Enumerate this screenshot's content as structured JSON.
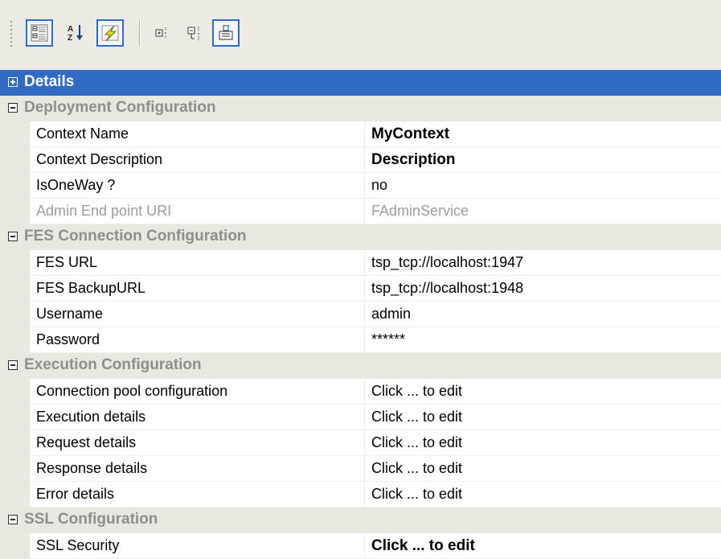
{
  "toolbar": {
    "buttons": [
      {
        "icon": "categorized-icon",
        "pressed": true
      },
      {
        "icon": "alphabetical-sort-icon",
        "pressed": false
      },
      {
        "icon": "properties-lightning-icon",
        "pressed": true
      },
      {
        "icon": "collapse-all-icon",
        "pressed": false
      },
      {
        "icon": "expand-all-icon",
        "pressed": false
      },
      {
        "icon": "property-pages-icon",
        "pressed": true
      }
    ]
  },
  "grid": {
    "details": {
      "label": "Details"
    },
    "deployment": {
      "label": "Deployment Configuration",
      "context_name": {
        "name": "Context Name",
        "value": "MyContext"
      },
      "context_description": {
        "name": "Context Description",
        "value": "Description"
      },
      "is_one_way": {
        "name": "IsOneWay ?",
        "value": "no"
      },
      "admin_uri": {
        "name": "Admin End point URI",
        "value": "FAdminService"
      }
    },
    "fes": {
      "label": "FES Connection Configuration",
      "url": {
        "name": "FES URL",
        "value": "tsp_tcp://localhost:1947"
      },
      "backup_url": {
        "name": "FES BackupURL",
        "value": "tsp_tcp://localhost:1948"
      },
      "username": {
        "name": "Username",
        "value": "admin"
      },
      "password": {
        "name": "Password",
        "value": "******"
      }
    },
    "execution": {
      "label": "Execution Configuration",
      "pool": {
        "name": "Connection pool configuration",
        "value": "Click ... to edit"
      },
      "exec_details": {
        "name": "Execution details",
        "value": "Click ... to edit"
      },
      "request": {
        "name": "Request details",
        "value": "Click ... to edit"
      },
      "response": {
        "name": "Response details",
        "value": "Click ... to edit"
      },
      "error": {
        "name": "Error details",
        "value": "Click ... to edit"
      }
    },
    "ssl": {
      "label": "SSL Configuration",
      "security": {
        "name": "SSL Security",
        "value": "Click ... to edit"
      }
    }
  },
  "colors": {
    "selection": "#316ac5",
    "category_bg": "#e9e8e0",
    "toolbar_bg": "#ebebe3",
    "pressed_border": "#3169c6"
  }
}
